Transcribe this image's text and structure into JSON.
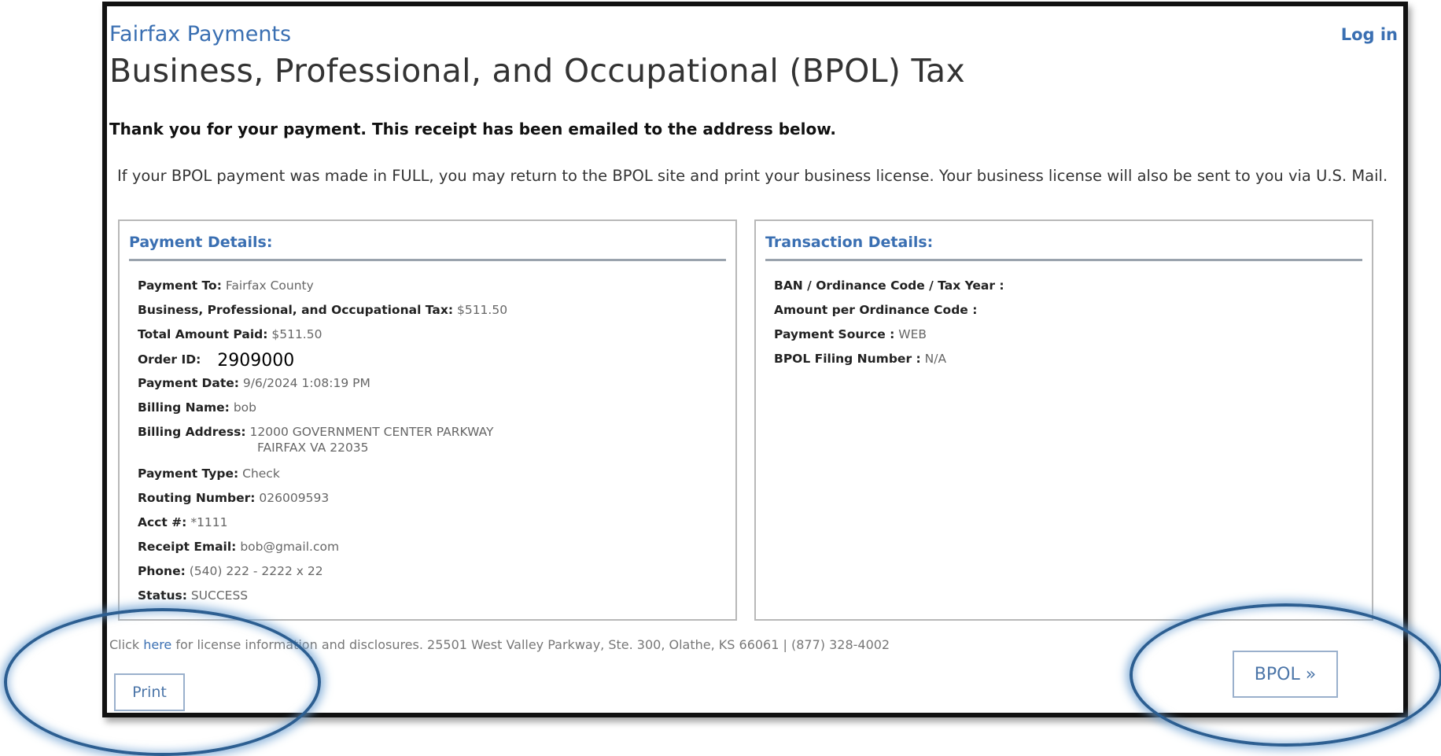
{
  "header": {
    "brand": "Fairfax Payments",
    "login_label": "Log in",
    "title": "Business, Professional, and Occupational (BPOL) Tax"
  },
  "thanks_message": "Thank you for your payment. This receipt has been emailed to the address below.",
  "info_message": "If your BPOL payment was made in FULL, you may return to the BPOL site and print your business license. Your business license will also be sent to you via U.S. Mail.",
  "payment_details": {
    "heading": "Payment Details:",
    "payment_to": {
      "label": "Payment To:",
      "value": "Fairfax County"
    },
    "bpol_tax": {
      "label": "Business, Professional, and Occupational Tax:",
      "value": "$511.50"
    },
    "total_paid": {
      "label": "Total Amount Paid:",
      "value": "$511.50"
    },
    "order_id": {
      "label": "Order ID:",
      "value": "2909000"
    },
    "payment_date": {
      "label": "Payment Date:",
      "value": "9/6/2024 1:08:19 PM"
    },
    "billing_name": {
      "label": "Billing Name:",
      "value": "bob"
    },
    "billing_address": {
      "label": "Billing Address:",
      "line1": "12000 GOVERNMENT CENTER PARKWAY",
      "line2": "FAIRFAX VA 22035"
    },
    "payment_type": {
      "label": "Payment Type:",
      "value": "Check"
    },
    "routing_number": {
      "label": "Routing Number:",
      "value": "026009593"
    },
    "acct": {
      "label": "Acct #:",
      "value": "*1111"
    },
    "receipt_email": {
      "label": "Receipt Email:",
      "value": "bob@gmail.com"
    },
    "phone": {
      "label": "Phone:",
      "value": "(540) 222 - 2222 x 22"
    },
    "status": {
      "label": "Status:",
      "value": "SUCCESS"
    }
  },
  "transaction_details": {
    "heading": "Transaction Details:",
    "ban_code_year": {
      "label": "BAN / Ordinance Code / Tax Year :",
      "value": ""
    },
    "amount_per_code": {
      "label": "Amount per Ordinance Code :",
      "value": ""
    },
    "payment_source": {
      "label": "Payment Source :",
      "value": "WEB"
    },
    "filing_number": {
      "label": "BPOL Filing Number :",
      "value": "N/A"
    }
  },
  "footer": {
    "prefix": "Click ",
    "link": "here",
    "rest": " for license information and disclosures. 25501 West Valley Parkway, Ste. 300, Olathe, KS 66061 | (877) 328-4002"
  },
  "buttons": {
    "print_label": "Print",
    "bpol_label": "BPOL »"
  },
  "colors": {
    "accent": "#3a6fb2",
    "annotation_ring": "#2c5e91"
  }
}
